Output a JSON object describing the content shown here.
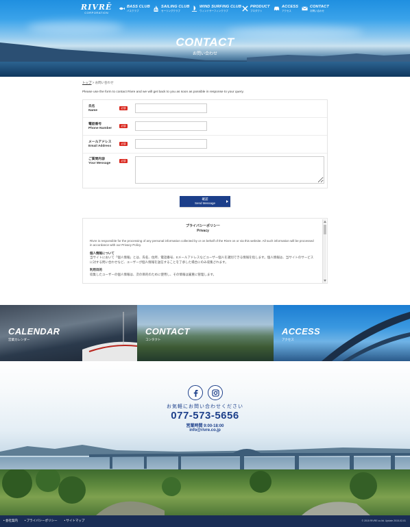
{
  "header": {
    "logo_main": "RIVRĒ",
    "logo_sub": "CORPORATION",
    "nav": [
      {
        "en": "BASS CLUB",
        "jp": "バスクラブ",
        "icon": "fish-icon"
      },
      {
        "en": "SAILING CLUB",
        "jp": "セーリングクラブ",
        "icon": "sailboat-icon"
      },
      {
        "en": "WIND SURFING CLUB",
        "jp": "ウィンドサーフィンクラブ",
        "icon": "windsurf-icon"
      },
      {
        "en": "PRODUCT",
        "jp": "プロダクト",
        "icon": "tools-icon"
      },
      {
        "en": "ACCESS",
        "jp": "アクセス",
        "icon": "car-icon"
      },
      {
        "en": "CONTACT",
        "jp": "お問い合わせ",
        "icon": "mail-icon"
      }
    ]
  },
  "hero": {
    "title_en": "CONTACT",
    "title_jp": "お問い合わせ"
  },
  "breadcrumb": {
    "home": "トップ",
    "sep": ">",
    "current": "お問い合わせ"
  },
  "intro": "Please use the form to contact Rivre and we will get back to you as soon as possible in response to your query.",
  "form": {
    "required_label": "必須",
    "fields": [
      {
        "jp": "氏名",
        "en": "Name",
        "value": ""
      },
      {
        "jp": "電話番号",
        "en": "Phone Number",
        "value": ""
      },
      {
        "jp": "メールアドレス",
        "en": "Email Address",
        "value": ""
      },
      {
        "jp": "ご質問内容",
        "en": "Your Message",
        "value": ""
      }
    ],
    "submit_jp": "確認",
    "submit_en": "Send Message"
  },
  "privacy": {
    "title_jp": "プライバシーポリシー",
    "title_en": "Privacy",
    "intro": "Rivre is responsible for the processing of any personal information collected by or on behalf of the Rivre on or via this website. All such information will be processed in accordance with our Privacy Policy.",
    "h1": "個人情報について",
    "p1": "当サイトにおいて「個人情報」とは、氏名、住所、電話番号、Eメールアドレスなどユーザー個人を識別できる情報を指します。個人情報は、当サイトのサービスに対する問い合わせなど、ユーザーが個人情報を送信することを了承した場合にのみ収集されます。",
    "h2": "利用目的",
    "p2": "収集したユーザーの個人情報は、次の目的のために使用し、その情報は厳重に管理します。"
  },
  "tiles": [
    {
      "en": "CALENDAR",
      "jp": "営業カレンダー"
    },
    {
      "en": "CONTACT",
      "jp": "コンタクト"
    },
    {
      "en": "ACCESS",
      "jp": "アクセス"
    }
  ],
  "contact_footer": {
    "line1": "お気軽にお問い合わせください",
    "phone": "077-573-5656",
    "hours": "営業時間 9:00-18:00",
    "email": "info@rivre.co.jp"
  },
  "bottombar": {
    "links": [
      "• 会社案内",
      "• プライバシーポリシー",
      "• サイトマップ"
    ],
    "copyright": "© 2015 RIVRE co.ltd. Update 2015-02-01"
  },
  "colors": {
    "brand_blue": "#1c3f8a",
    "required_red": "#d9261c",
    "footer_bar": "#1a2d55"
  }
}
